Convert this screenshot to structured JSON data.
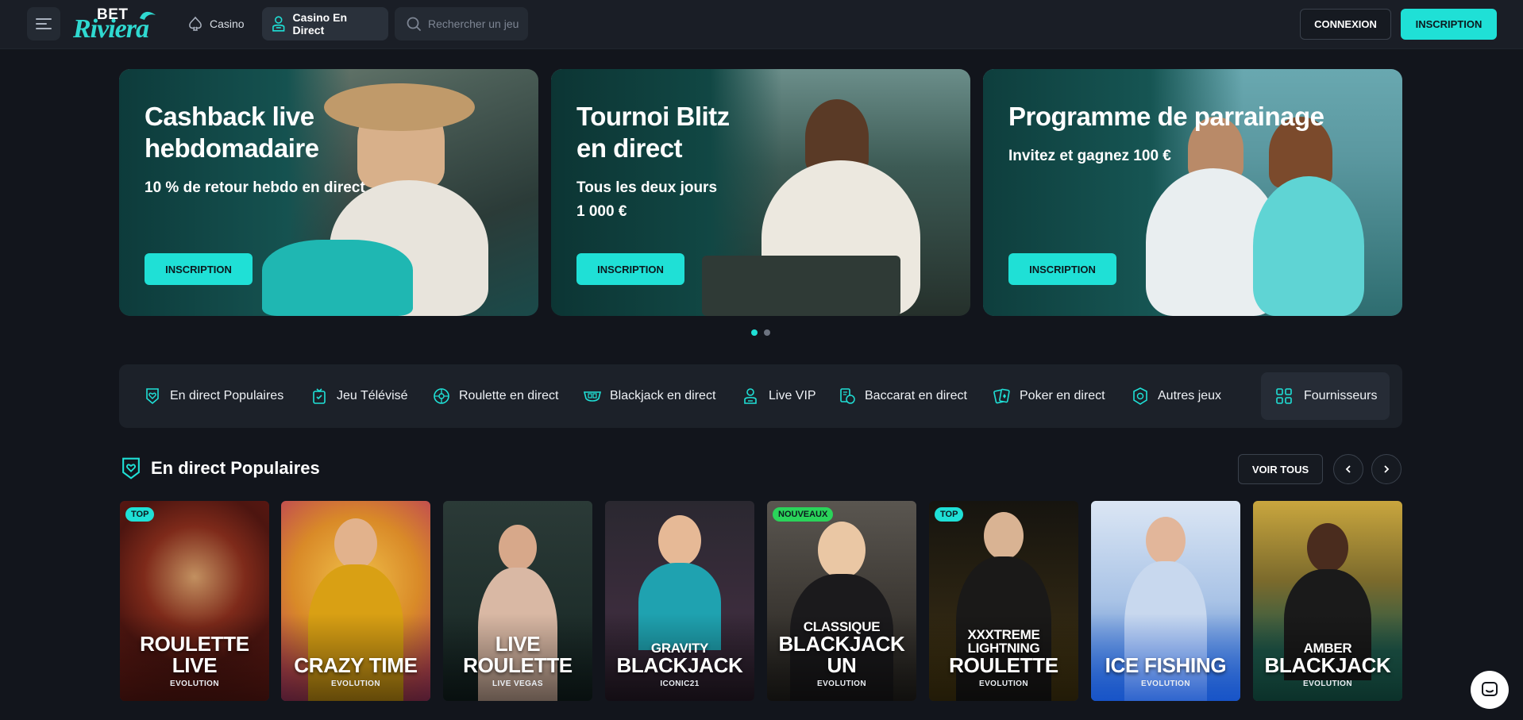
{
  "header": {
    "logo_top": "BET",
    "logo_bottom": "Riviera",
    "nav_casino": "Casino",
    "nav_live": "Casino En Direct",
    "search_placeholder": "Rechercher un jeu",
    "login": "CONNEXION",
    "signup": "INSCRIPTION"
  },
  "promos": [
    {
      "title_l1": "Cashback live",
      "title_l2": "hebdomadaire",
      "sub_l1": "10 % de retour hebdo en direct",
      "sub_l2": "",
      "button": "INSCRIPTION"
    },
    {
      "title_l1": "Tournoi Blitz",
      "title_l2": "en direct",
      "sub_l1": "Tous les deux jours",
      "sub_l2": "1 000 €",
      "button": "INSCRIPTION"
    },
    {
      "title_l1": "Programme de parrainage",
      "title_l2": "",
      "sub_l1": "Invitez et gagnez 100 €",
      "sub_l2": "",
      "button": "INSCRIPTION"
    }
  ],
  "carousel": {
    "pages": 2,
    "active": 1
  },
  "categories": [
    {
      "label": "En direct Populaires",
      "icon": "heart-shield-icon"
    },
    {
      "label": "Jeu Télévisé",
      "icon": "tv-game-icon"
    },
    {
      "label": "Roulette en direct",
      "icon": "roulette-icon"
    },
    {
      "label": "Blackjack en direct",
      "icon": "blackjack-icon"
    },
    {
      "label": "Live VIP",
      "icon": "vip-dealer-icon"
    },
    {
      "label": "Baccarat en direct",
      "icon": "baccarat-icon"
    },
    {
      "label": "Poker en direct",
      "icon": "poker-icon"
    },
    {
      "label": "Autres jeux",
      "icon": "other-games-icon"
    }
  ],
  "providers_label": "Fournisseurs",
  "section": {
    "title": "En direct Populaires",
    "view_all": "VOIR TOUS"
  },
  "games": [
    {
      "badge": "TOP",
      "line1": "",
      "line2": "Roulette",
      "line3": "Live",
      "provider": "EVOLUTION"
    },
    {
      "badge": "",
      "line1": "",
      "line2": "Crazy Time",
      "line3": "",
      "provider": "EVOLUTION"
    },
    {
      "badge": "",
      "line1": "",
      "line2": "Live",
      "line3": "Roulette",
      "provider": "LIVE VEGAS"
    },
    {
      "badge": "",
      "line1": "Gravity",
      "line2": "Blackjack",
      "line3": "",
      "provider": "ICONIC21"
    },
    {
      "badge": "NOUVEAUX",
      "line1": "Classique",
      "line2": "Blackjack",
      "line3": "Un",
      "provider": "EVOLUTION"
    },
    {
      "badge": "TOP",
      "line1": "XXXtreme Lightning",
      "line2": "Roulette",
      "line3": "",
      "provider": "EVOLUTION"
    },
    {
      "badge": "",
      "line1": "",
      "line2": "Ice Fishing",
      "line3": "",
      "provider": "EVOLUTION"
    },
    {
      "badge": "",
      "line1": "Amber",
      "line2": "Blackjack",
      "line3": "",
      "provider": "EVOLUTION"
    }
  ],
  "colors": {
    "accent": "#1fe0d6",
    "background": "#12151c",
    "header": "#1a1e26",
    "new_badge": "#2ad45a"
  }
}
